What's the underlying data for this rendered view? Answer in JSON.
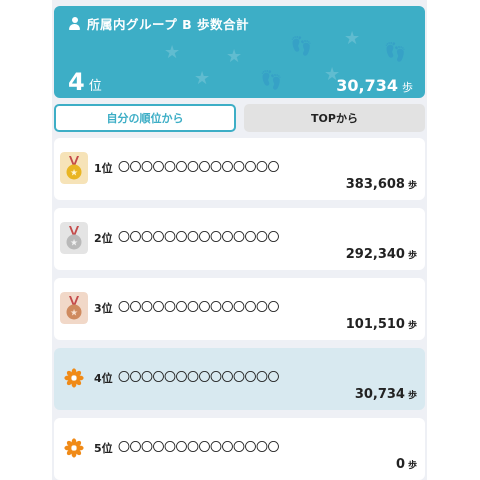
{
  "summary": {
    "title": "所属内グループ B  歩数合計",
    "rank": "4",
    "rank_unit": "位",
    "steps": "30,734",
    "steps_unit": "歩",
    "colors": {
      "background": "#3daec6",
      "text": "#ffffff"
    },
    "icon": "user-icon"
  },
  "tabs": [
    {
      "label": "自分の順位から",
      "active": true
    },
    {
      "label": "TOPから",
      "active": false
    }
  ],
  "ranking": [
    {
      "rank": "1位",
      "name": "〇〇〇〇〇〇〇〇〇〇〇〇〇〇",
      "steps": "383,608",
      "unit": "歩",
      "icon": "gold-medal-icon",
      "highlight": false
    },
    {
      "rank": "2位",
      "name": "〇〇〇〇〇〇〇〇〇〇〇〇〇〇",
      "steps": "292,340",
      "unit": "歩",
      "icon": "silver-medal-icon",
      "highlight": false
    },
    {
      "rank": "3位",
      "name": "〇〇〇〇〇〇〇〇〇〇〇〇〇〇",
      "steps": "101,510",
      "unit": "歩",
      "icon": "bronze-medal-icon",
      "highlight": false
    },
    {
      "rank": "4位",
      "name": "〇〇〇〇〇〇〇〇〇〇〇〇〇〇",
      "steps": "30,734",
      "unit": "歩",
      "icon": "flower-icon",
      "highlight": true
    },
    {
      "rank": "5位",
      "name": "〇〇〇〇〇〇〇〇〇〇〇〇〇〇",
      "steps": "0",
      "unit": "歩",
      "icon": "flower-icon",
      "highlight": false
    }
  ],
  "medal_colors": {
    "gold": {
      "bg": "#f6e3b8",
      "medal": "#e9b522",
      "ribbon": "#c44a4a"
    },
    "silver": {
      "bg": "#e4e4e4",
      "medal": "#b9b9b9",
      "ribbon": "#c44a4a"
    },
    "bronze": {
      "bg": "#f1d8c8",
      "medal": "#cf8a5e",
      "ribbon": "#c44a4a"
    }
  },
  "flower_color": "#f08a17",
  "highlight_color": "#d8e9f0"
}
